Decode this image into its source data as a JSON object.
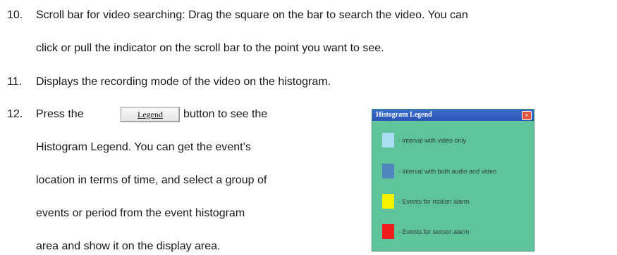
{
  "items": [
    {
      "number": "10.",
      "lines": [
        "Scroll bar for video searching: Drag the square on the bar to search the video. You can",
        "click or pull the indicator on the scroll bar to the point you want to see."
      ]
    },
    {
      "number": "11.",
      "lines": [
        "Displays the recording mode of the video on the histogram."
      ]
    },
    {
      "number": "12.",
      "lines": [
        "Press the",
        "button to see the",
        "Histogram Legend. You can get the event’s",
        "location in terms of time, and select a group of",
        "events or period from the event histogram",
        "area and show it on the display area."
      ]
    }
  ],
  "legend_button_label": "Legend",
  "histogram_window": {
    "title": "Histogram Legend",
    "close_symbol": "×",
    "background_color": "#5fc49c",
    "entries": [
      {
        "label": "- interval with video only",
        "color": "#a9dff0"
      },
      {
        "label": "- interval with both audio and video",
        "color": "#4f86be"
      },
      {
        "label": "- Events for motion alarm",
        "color": "#f7f200"
      },
      {
        "label": "- Events for sensor alarm",
        "color": "#ee1c1c"
      }
    ]
  }
}
